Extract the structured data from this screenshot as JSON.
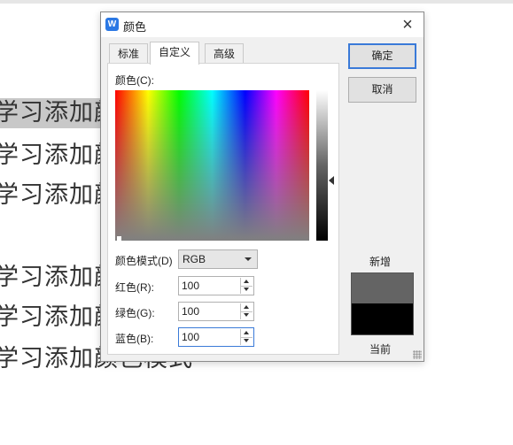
{
  "document": {
    "lines": [
      {
        "text": "学习添加颜色模式"
      },
      {
        "text": "学习添加颜色模式"
      },
      {
        "text": "学习添加颜色模式"
      },
      {
        "text": "学习添加颜色模式"
      },
      {
        "text": "学习添加颜色模式"
      },
      {
        "text": "学习添加颜色模式"
      }
    ]
  },
  "dialog": {
    "app_icon_letter": "W",
    "title": "颜色",
    "close_symbol": "×",
    "tabs": [
      {
        "label": "标准",
        "active": false
      },
      {
        "label": "自定义",
        "active": true
      },
      {
        "label": "高级",
        "active": false
      }
    ],
    "color_label": "颜色(C):",
    "color_mode_label": "颜色模式(D)",
    "color_mode_value": "RGB",
    "red_label": "红色(R):",
    "red_value": "100",
    "green_label": "绿色(G):",
    "green_value": "100",
    "blue_label": "蓝色(B):",
    "blue_value": "100",
    "ok_label": "确定",
    "cancel_label": "取消",
    "new_label": "新增",
    "current_label": "当前",
    "new_color": "#646464",
    "current_color": "#000000",
    "icons": [
      "close-icon",
      "dropdown-arrow-icon",
      "spin-up-icon",
      "spin-down-icon",
      "luminance-slider-arrow-icon",
      "resize-grip-icon"
    ]
  }
}
